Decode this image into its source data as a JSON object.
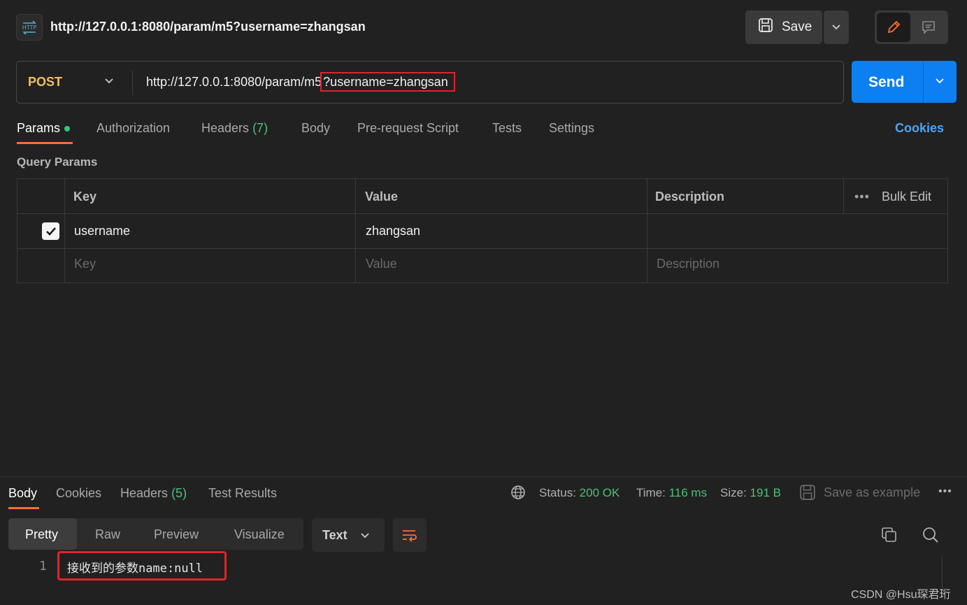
{
  "request": {
    "icon_label": "HTTP",
    "title": "http://127.0.0.1:8080/param/m5?username=zhangsan",
    "save_label": "Save",
    "method": "POST",
    "url_base": "http://127.0.0.1:8080/param/m5",
    "url_query": "?username=zhangsan",
    "send_label": "Send"
  },
  "tabs": {
    "params": "Params",
    "authorization": "Authorization",
    "headers": "Headers",
    "headers_count": "(7)",
    "body": "Body",
    "pre_request": "Pre-request Script",
    "tests": "Tests",
    "settings": "Settings",
    "cookies": "Cookies"
  },
  "query_params": {
    "section_title": "Query Params",
    "columns": {
      "key": "Key",
      "value": "Value",
      "description": "Description"
    },
    "bulk_dots": "•••",
    "bulk_edit": "Bulk Edit",
    "rows": [
      {
        "checked": true,
        "key": "username",
        "value": "zhangsan",
        "description": ""
      }
    ],
    "placeholders": {
      "key": "Key",
      "value": "Value",
      "description": "Description"
    }
  },
  "response": {
    "tabs": {
      "body": "Body",
      "cookies": "Cookies",
      "headers": "Headers",
      "headers_count": "(5)",
      "test_results": "Test Results"
    },
    "status_label": "Status:",
    "status_value": "200 OK",
    "time_label": "Time:",
    "time_value": "116 ms",
    "size_label": "Size:",
    "size_value": "191 B",
    "save_example": "Save as example",
    "more": "•••",
    "views": {
      "pretty": "Pretty",
      "raw": "Raw",
      "preview": "Preview",
      "visualize": "Visualize"
    },
    "format": "Text",
    "lines": [
      {
        "number": "1",
        "text": "接收到的参数name:null"
      }
    ]
  },
  "watermark": "CSDN @Hsu琛君珩",
  "colors": {
    "accent": "#ff6c37",
    "send": "#0c7ff2",
    "method": "#f0c060",
    "success": "#4cc176",
    "link": "#4ea3f5",
    "highlight": "#e0242a"
  }
}
